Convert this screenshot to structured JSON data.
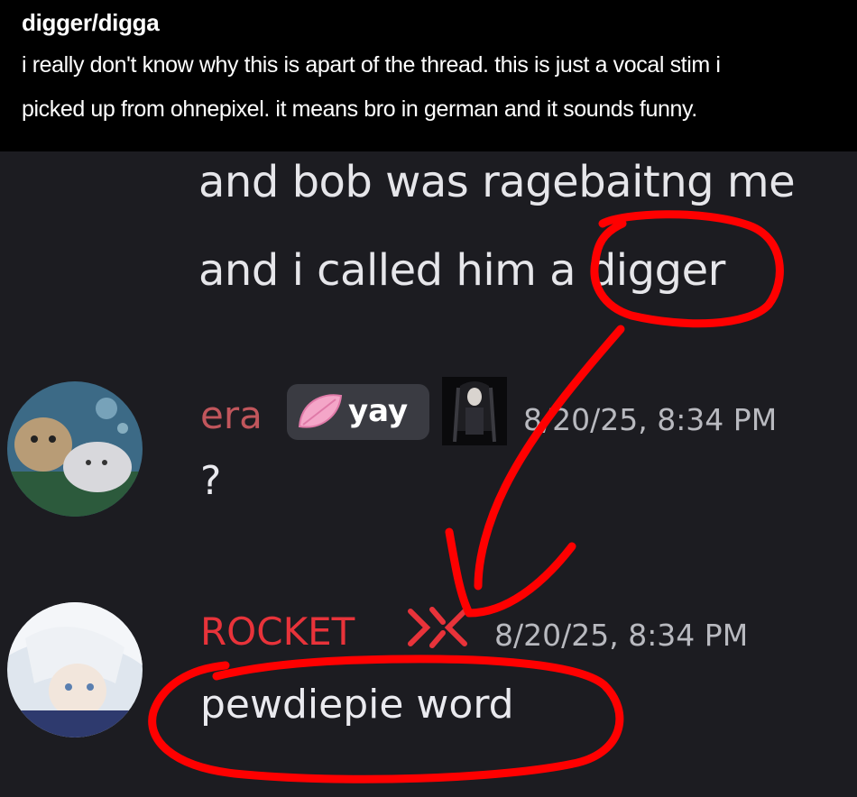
{
  "caption": {
    "title": "digger/digga",
    "line1": "i really don't know why this is apart of the thread. this is just a vocal stim i",
    "line2": "picked up from ohnepixel. it means bro in german and it sounds funny."
  },
  "previous_message": {
    "line1": "and bob was ragebaitng me",
    "line2": "and i called him a digger"
  },
  "messages": [
    {
      "username": "era",
      "username_color": "#c1565c",
      "tag_label": "yay",
      "tag_icon": "pink-leaf-icon",
      "role_image": "anime-character-image",
      "timestamp": "8/20/25, 8:34 PM",
      "text": "?"
    },
    {
      "username": "ROCKET",
      "username_color": "#e8333a",
      "role_icon": "crossed-x-icon",
      "timestamp": "8/20/25, 8:34 PM",
      "text": "pewdiepie word"
    }
  ],
  "annotation_color": "#ff0000"
}
